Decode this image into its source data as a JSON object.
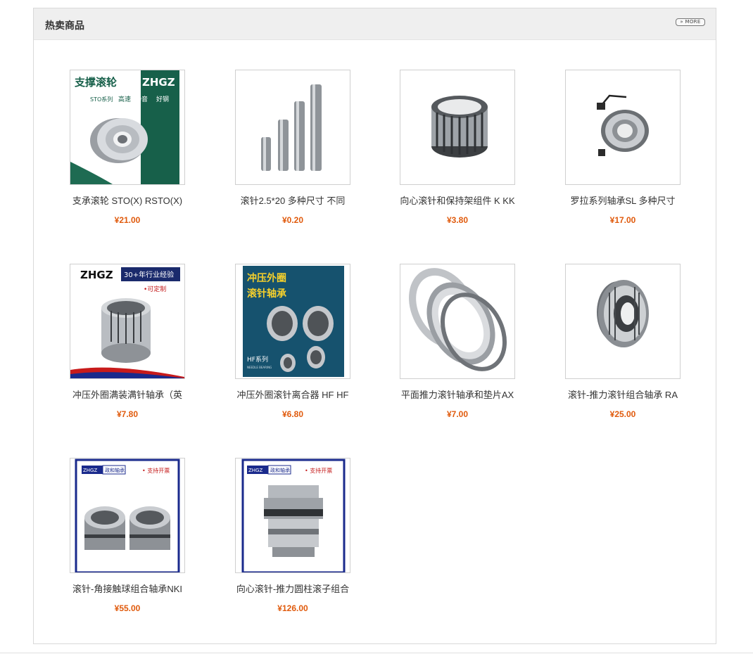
{
  "section": {
    "title": "热卖商品",
    "more_label": "» MORE"
  },
  "products": [
    {
      "name": "支承滚轮 STO(X) RSTO(X)",
      "price": "¥21.00",
      "image_texts": [
        "支撑滚轮",
        "ZHGZ",
        "STO系列",
        "高速",
        "静音",
        "好钢"
      ]
    },
    {
      "name": "滚针2.5*20 多种尺寸 不同",
      "price": "¥0.20"
    },
    {
      "name": "向心滚针和保持架组件 K KK",
      "price": "¥3.80"
    },
    {
      "name": "罗拉系列轴承SL 多种尺寸",
      "price": "¥17.00"
    },
    {
      "name": "冲压外圈满装满针轴承（英",
      "price": "¥7.80",
      "image_texts": [
        "ZHGZ",
        "30+年行业经验",
        "•可定制"
      ]
    },
    {
      "name": "冲压外圈滚针离合器 HF HF",
      "price": "¥6.80",
      "image_texts": [
        "冲压外圈",
        "滚针轴承",
        "HF系列",
        "NEEDLE BEARING"
      ]
    },
    {
      "name": "平面推力滚针轴承和垫片AX",
      "price": "¥7.00"
    },
    {
      "name": "滚针-推力滚针组合轴承 RA",
      "price": "¥25.00"
    },
    {
      "name": "滚针-角接触球组合轴承NKI",
      "price": "¥55.00",
      "image_texts": [
        "ZHGZ",
        "政和轴承",
        "• 支持开票"
      ]
    },
    {
      "name": "向心滚针-推力圆柱滚子组合",
      "price": "¥126.00",
      "image_texts": [
        "ZHGZ",
        "政和轴承",
        "• 支持开票"
      ]
    }
  ],
  "colors": {
    "price": "#e05a0c",
    "header_bg": "#efefef",
    "border": "#d9d9d9"
  }
}
